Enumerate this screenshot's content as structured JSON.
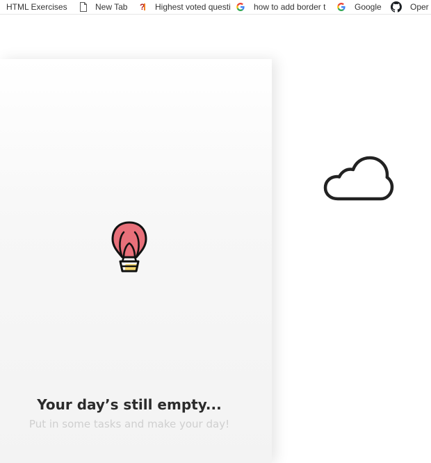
{
  "bookmarks_bar": {
    "items": [
      {
        "label": "HTML Exercises",
        "icon": "none"
      },
      {
        "label": "New Tab",
        "icon": "page-icon"
      },
      {
        "label": "Highest voted questi",
        "icon": "stackoverflow-icon"
      },
      {
        "label": "how to add border t",
        "icon": "google-icon"
      },
      {
        "label": "Google",
        "icon": "google-icon"
      },
      {
        "label": "Oper",
        "icon": "github-icon"
      }
    ]
  },
  "empty_state": {
    "title": "Your day’s still empty...",
    "subtitle": "Put in some tasks and make your day!",
    "illustration": "hot-air-balloon-icon"
  },
  "weather": {
    "icon": "cloud-icon"
  },
  "colors": {
    "balloon_fill": "#e8707a",
    "basket_accent": "#f5d76e",
    "title_text": "#2b2b2b",
    "subtitle_text": "#cfcfcf"
  }
}
